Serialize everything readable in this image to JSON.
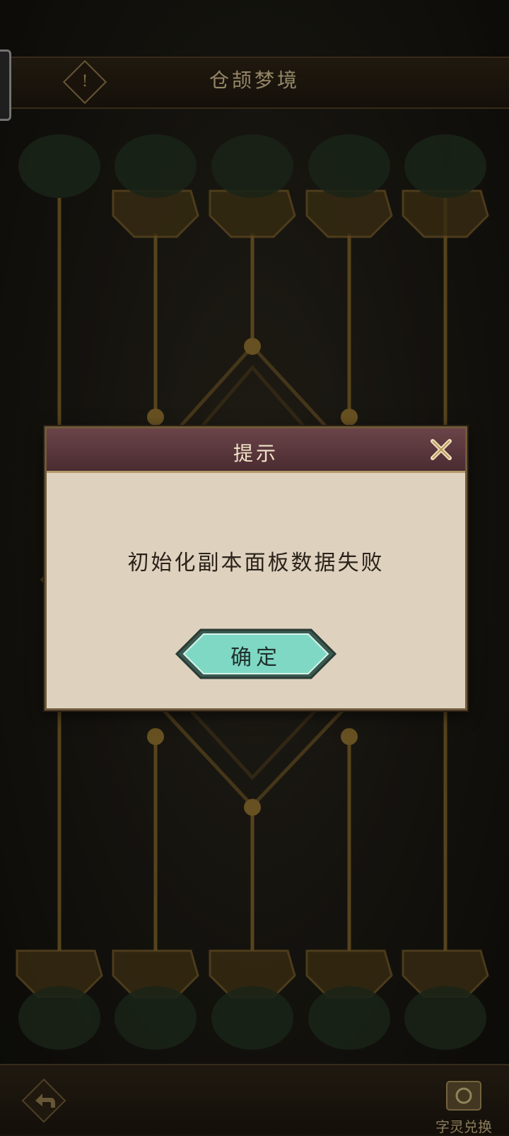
{
  "header": {
    "title": "仓颉梦境",
    "info_icon": "info-icon"
  },
  "dialog": {
    "title": "提示",
    "message": "初始化副本面板数据失败",
    "confirm_label": "确定",
    "close_icon": "close-icon"
  },
  "bottom": {
    "back_icon": "back-arrow-icon",
    "exchange_label": "字灵兑换"
  },
  "colors": {
    "gold": "#c9b58a",
    "dialog_bg": "#ded2bf",
    "dialog_header": "#5a363b",
    "confirm_button": "#74d3c0"
  }
}
